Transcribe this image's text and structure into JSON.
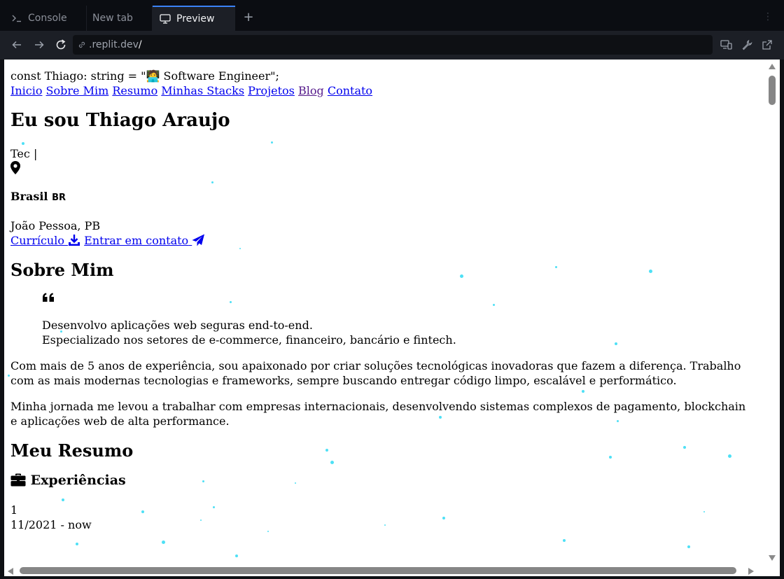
{
  "tabs": {
    "console": "Console",
    "new_tab": "New tab",
    "preview": "Preview",
    "add": "+",
    "menu": "⋮"
  },
  "address_bar": {
    "url_host": ".replit.dev",
    "url_path": "/"
  },
  "page": {
    "code_line": "const Thiago: string = \"🧑‍💻 Software Engineer\";",
    "nav_links": [
      {
        "label": "Inicio"
      },
      {
        "label": "Sobre Mim"
      },
      {
        "label": "Resumo"
      },
      {
        "label": "Minhas Stacks"
      },
      {
        "label": "Projetos"
      },
      {
        "label": "Blog"
      },
      {
        "label": "Contato"
      }
    ],
    "hero_title": "Eu sou Thiago Araujo",
    "typing_text": "Tec |",
    "country": "Brasil",
    "country_code": "BR",
    "city": "João Pessoa, PB",
    "cv_link": "Currículo",
    "contact_link": "Entrar em contato",
    "about_title": "Sobre Mim",
    "quote_line1": "Desenvolvo aplicações web seguras end-to-end.",
    "quote_line2": "Especializado nos setores de e-commerce, financeiro, bancário e fintech.",
    "about_p1": "Com mais de 5 anos de experiência, sou apaixonado por criar soluções tecnológicas inovadoras que fazem a diferença. Trabalho com as mais modernas tecnologias e frameworks, sempre buscando entregar código limpo, escalável e performático.",
    "about_p2": "Minha jornada me levou a trabalhar com empresas internacionais, desenvolvendo sistemas complexos de pagamento, blockchain e aplicações web de alta performance.",
    "resume_title": "Meu Resumo",
    "experience_title": "Experiências",
    "exp_index": "1",
    "exp_period": "11/2021 - now"
  },
  "colors": {
    "link": "#0000ee",
    "visited_link": "#551a8b",
    "particles": "#4ee0f5",
    "active_tab_accent": "#3b82f6"
  }
}
